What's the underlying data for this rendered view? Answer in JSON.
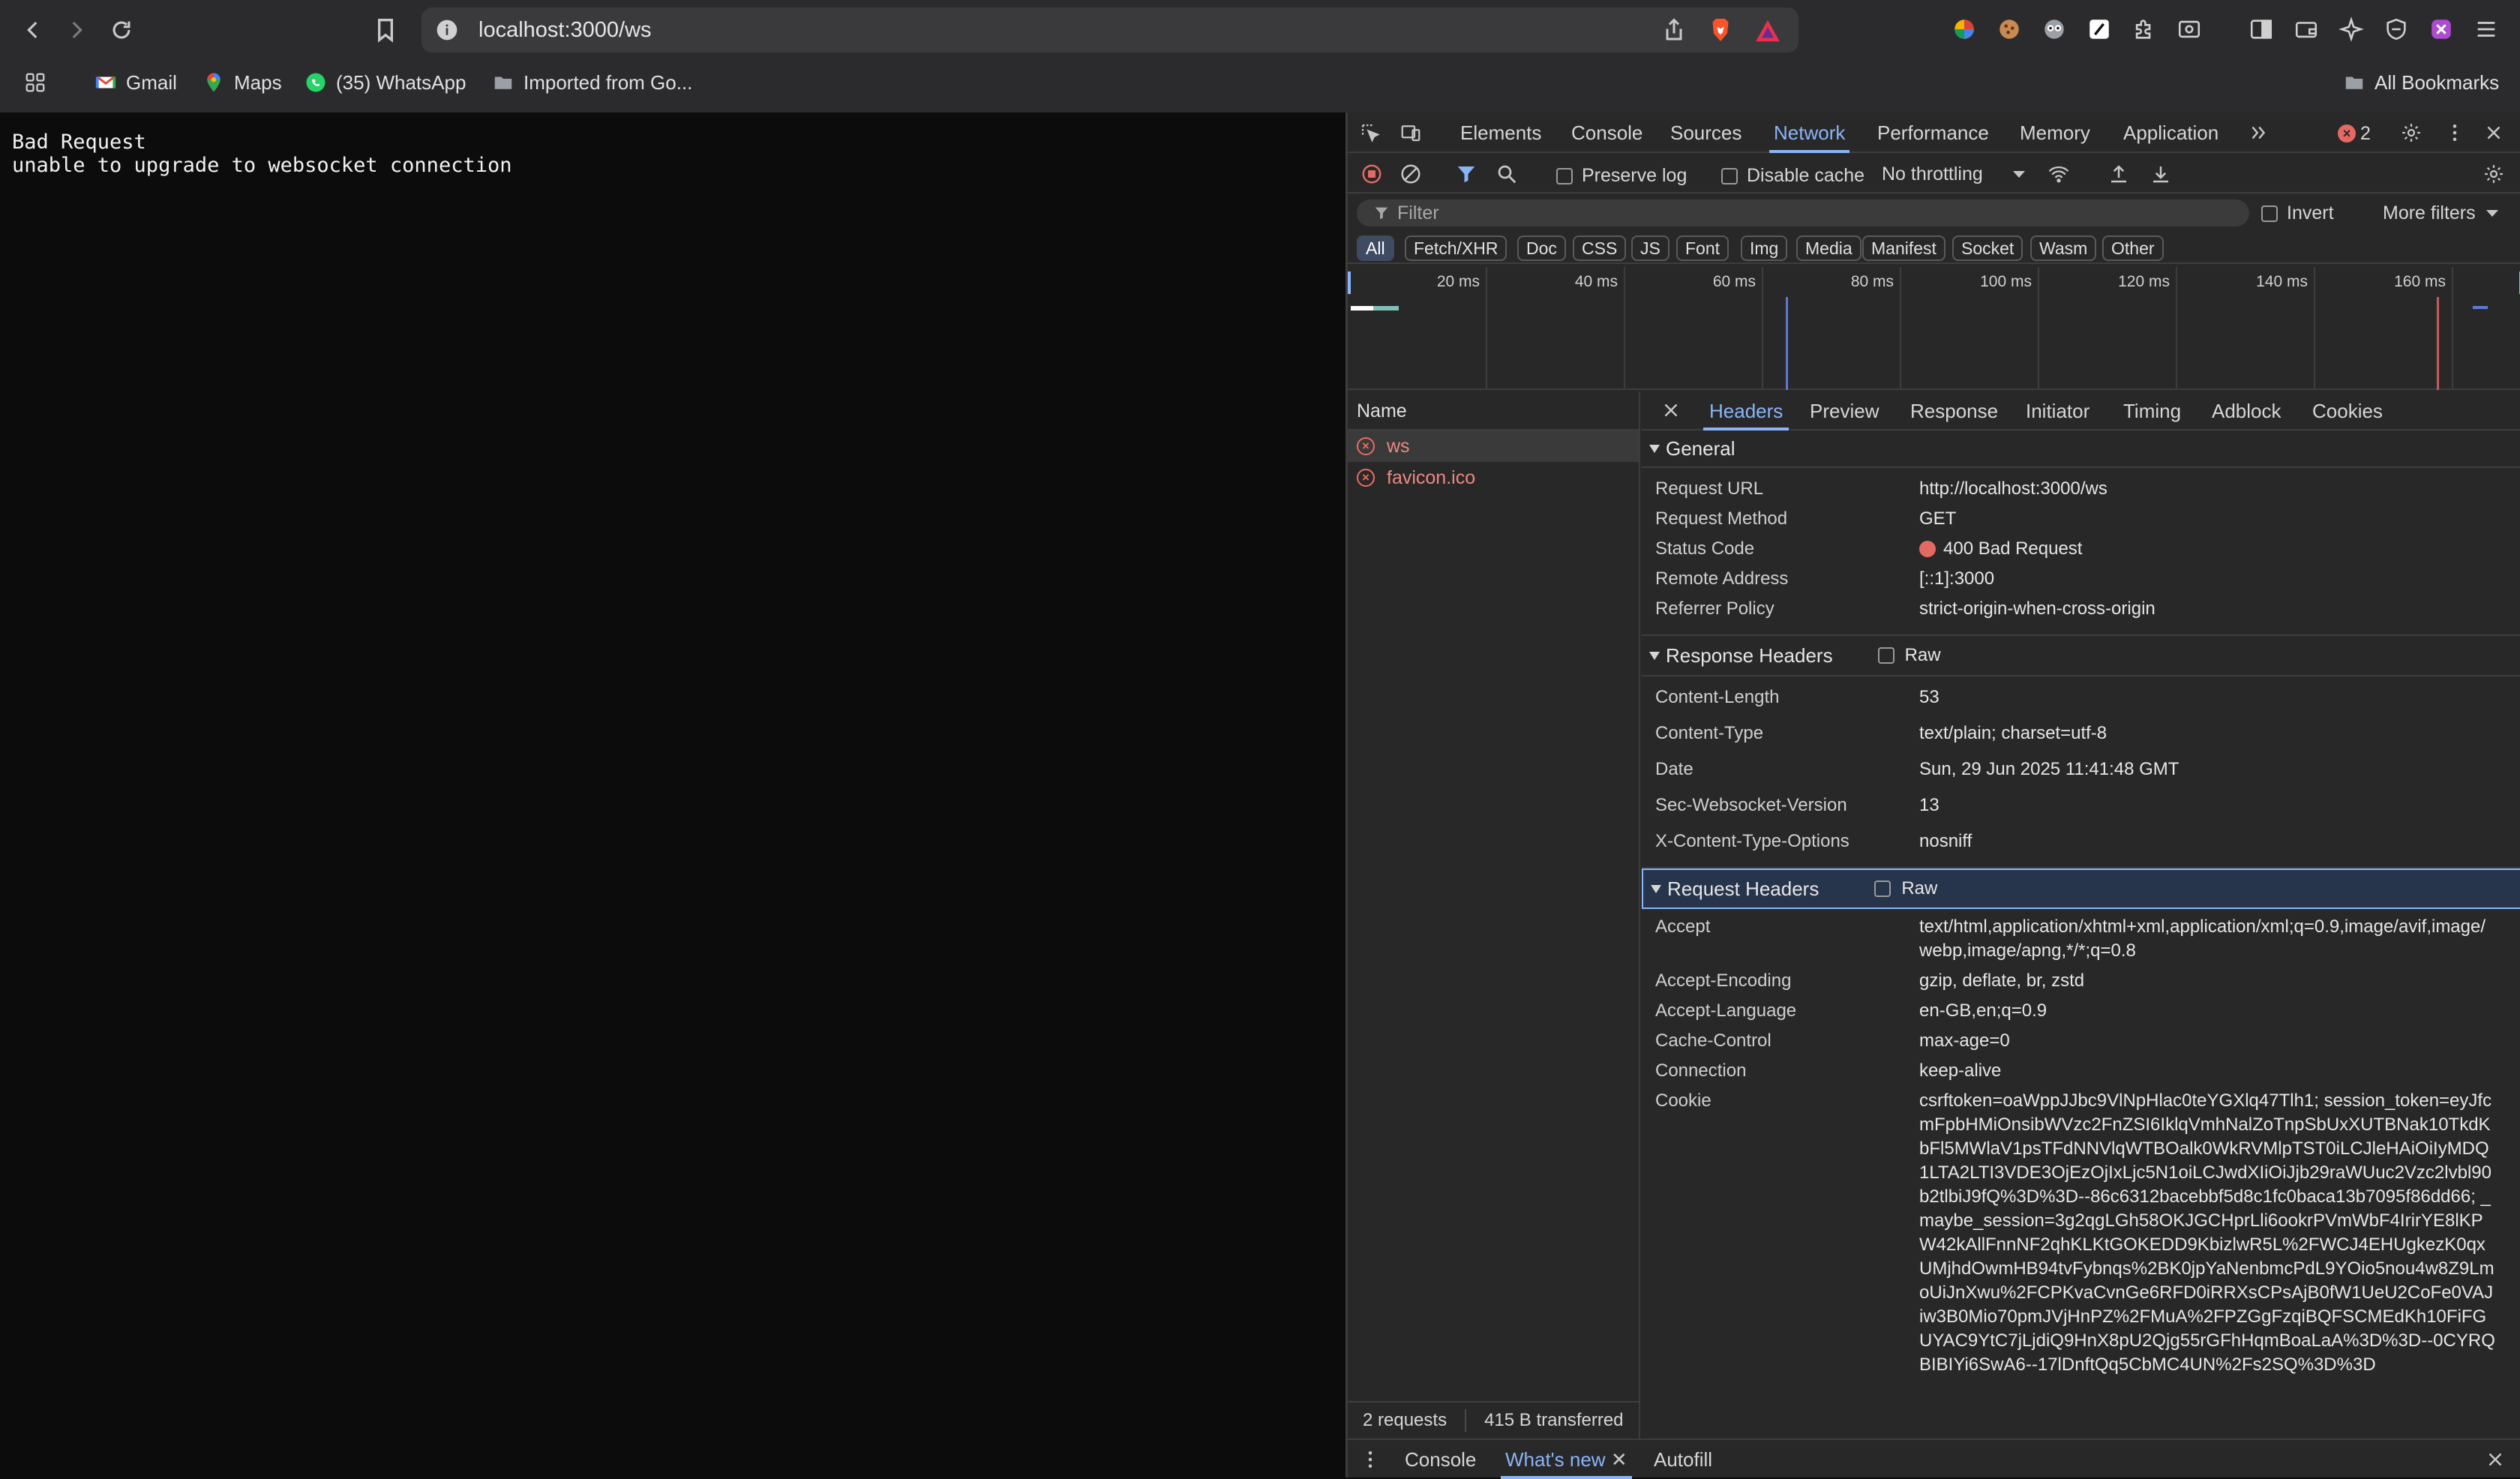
{
  "browser": {
    "url": "localhost:3000/ws",
    "bookmarks": [
      {
        "label": "Gmail"
      },
      {
        "label": "Maps"
      },
      {
        "label": "(35) WhatsApp"
      },
      {
        "label": "Imported from Go..."
      }
    ],
    "all_bookmarks": "All Bookmarks"
  },
  "page": {
    "lines": [
      "Bad Request",
      "unable to upgrade to websocket connection"
    ]
  },
  "devtools": {
    "tabs": [
      "Elements",
      "Console",
      "Sources",
      "Network",
      "Performance",
      "Memory",
      "Application"
    ],
    "active_tab": "Network",
    "error_count": "2",
    "toolbar": {
      "preserve_log": "Preserve log",
      "disable_cache": "Disable cache",
      "throttling": "No throttling"
    },
    "filter": {
      "placeholder": "Filter",
      "invert": "Invert",
      "more_filters": "More filters"
    },
    "types": [
      "All",
      "Fetch/XHR",
      "Doc",
      "CSS",
      "JS",
      "Font",
      "Img",
      "Media",
      "Manifest",
      "Socket",
      "Wasm",
      "Other"
    ],
    "overview_ticks": [
      "20 ms",
      "40 ms",
      "60 ms",
      "80 ms",
      "100 ms",
      "120 ms",
      "140 ms",
      "160 ms"
    ],
    "request_list": {
      "header": "Name",
      "items": [
        "ws",
        "favicon.ico"
      ],
      "footer_requests": "2 requests",
      "footer_transferred": "415 B transferred"
    },
    "details": {
      "tabs": [
        "Headers",
        "Preview",
        "Response",
        "Initiator",
        "Timing",
        "Adblock",
        "Cookies"
      ],
      "general": {
        "title": "General",
        "rows": [
          {
            "k": "Request URL",
            "v": "http://localhost:3000/ws"
          },
          {
            "k": "Request Method",
            "v": "GET"
          },
          {
            "k": "Status Code",
            "v": "400 Bad Request"
          },
          {
            "k": "Remote Address",
            "v": "[::1]:3000"
          },
          {
            "k": "Referrer Policy",
            "v": "strict-origin-when-cross-origin"
          }
        ]
      },
      "response_headers": {
        "title": "Response Headers",
        "raw": "Raw",
        "rows": [
          {
            "k": "Content-Length",
            "v": "53"
          },
          {
            "k": "Content-Type",
            "v": "text/plain; charset=utf-8"
          },
          {
            "k": "Date",
            "v": "Sun, 29 Jun 2025 11:41:48 GMT"
          },
          {
            "k": "Sec-Websocket-Version",
            "v": "13"
          },
          {
            "k": "X-Content-Type-Options",
            "v": "nosniff"
          }
        ]
      },
      "request_headers": {
        "title": "Request Headers",
        "raw": "Raw",
        "rows": [
          {
            "k": "Accept",
            "v": "text/html,application/xhtml+xml,application/xml;q=0.9,image/avif,image/webp,image/apng,*/*;q=0.8"
          },
          {
            "k": "Accept-Encoding",
            "v": "gzip, deflate, br, zstd"
          },
          {
            "k": "Accept-Language",
            "v": "en-GB,en;q=0.9"
          },
          {
            "k": "Cache-Control",
            "v": "max-age=0"
          },
          {
            "k": "Connection",
            "v": "keep-alive"
          },
          {
            "k": "Cookie",
            "v": "csrftoken=oaWppJJbc9VlNpHlac0teYGXlq47Tlh1; session_token=eyJfcmFpbHMiOnsibWVzc2FnZSI6IklqVmhNalZoTnpSbUxXUTBNak10TkdKbFl5MWlaV1psTFdNNVlqWTBOalk0WkRVMlpTST0iLCJleHAiOiIyMDQ1LTA2LTI3VDE3OjEzOjIxLjc5N1oiLCJwdXIiOiJjb29raWUuc2Vzc2lvbl90b2tlbiJ9fQ%3D%3D--86c6312bacebbf5d8c1fc0baca13b7095f86dd66; _maybe_session=3g2qgLGh58OKJGCHprLli6ookrPVmWbF4IrirYE8lKPW42kAllFnnNF2qhKLKtGOKEDD9KbizlwR5L%2FWCJ4EHUgkezK0qxUMjhdOwmHB94tvFybnqs%2BK0jpYaNenbmcPdL9YOio5nou4w8Z9LmoUiJnXwu%2FCPKvaCvnGe6RFD0iRRXsCPsAjB0fW1UeU2CoFe0VAJiw3B0Mio70pmJVjHnPZ%2FMuA%2FPZGgFzqiBQFSCMEdKh10FiFGUYAC9YtC7jLjdiQ9HnX8pU2Qjg55rGFhHqmBoaLaA%3D%3D--0CYRQBIBIYi6SwA6--17lDnftQq5CbMC4UN%2Fs2SQ%3D%3D"
          }
        ]
      }
    },
    "drawer": {
      "tabs": [
        "Console",
        "What's new",
        "Autofill"
      ]
    }
  }
}
